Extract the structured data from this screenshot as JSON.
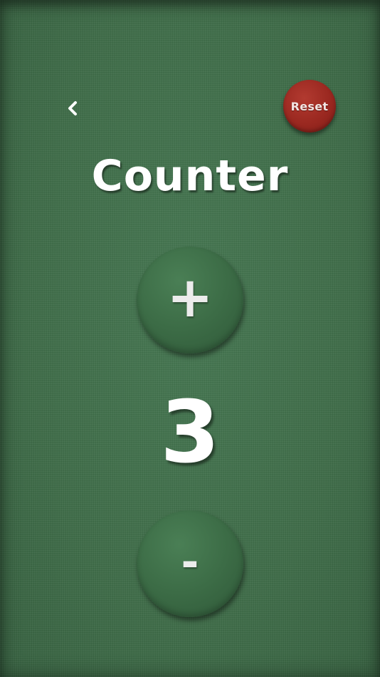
{
  "header": {
    "back_icon": "chevron-left-icon",
    "reset_label": "Reset"
  },
  "main": {
    "title": "Counter",
    "increment_label": "+",
    "count": "3",
    "decrement_label": "-"
  },
  "colors": {
    "background": "#3f6e49",
    "reset_button": "#9a2820",
    "round_button": "#3c6c46",
    "text": "#ffffff"
  }
}
